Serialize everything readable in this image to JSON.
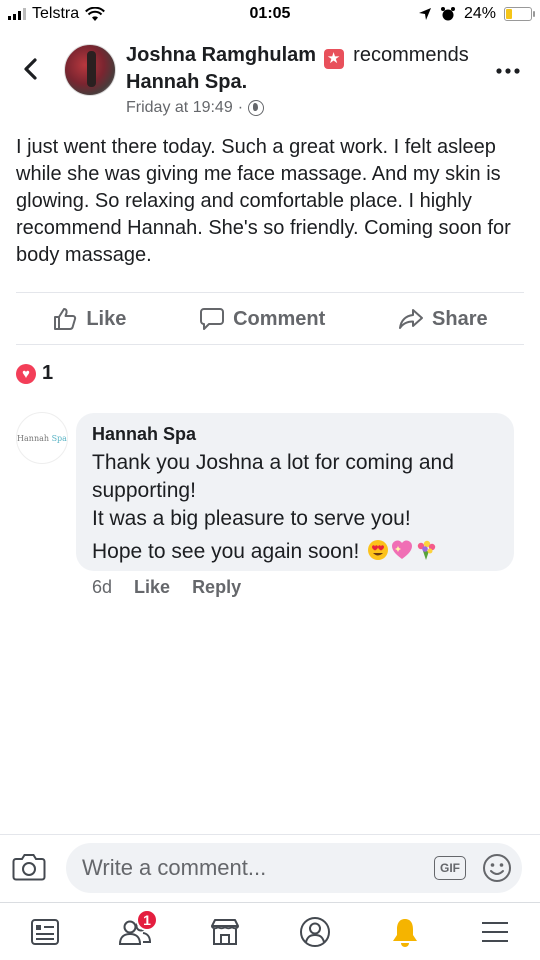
{
  "status_bar": {
    "carrier": "Telstra",
    "time": "01:05",
    "battery_percent": "24%",
    "battery_level": 0.24
  },
  "post": {
    "author": "Joshna Ramghulam",
    "verb": "recommends",
    "page": "Hannah Spa.",
    "timestamp": "Friday at 19:49",
    "separator": "·",
    "body": "I just went there today. Such a great work. I felt asleep while she was giving me face massage. And my skin is glowing. So relaxing and comfortable place. I highly recommend Hannah. She's so friendly. Coming soon for body massage."
  },
  "actions": {
    "like": "Like",
    "comment": "Comment",
    "share": "Share"
  },
  "reactions": {
    "count": "1"
  },
  "comment": {
    "avatar_text_1": "Hannah",
    "avatar_text_2": "Spa",
    "author": "Hannah Spa",
    "lines": [
      "Thank you Joshna a lot for coming and",
      "supporting!",
      "It was a big pleasure to serve you!",
      "Hope to see you again soon!"
    ],
    "age": "6d",
    "like": "Like",
    "reply": "Reply"
  },
  "composer": {
    "placeholder": "Write a comment...",
    "gif_label": "GIF"
  },
  "nav": {
    "friends_badge": "1"
  },
  "colors": {
    "brand_blue": "#1877f2",
    "heart": "#f33e58",
    "badge": "#e41e3f",
    "bell": "#f5b400"
  }
}
